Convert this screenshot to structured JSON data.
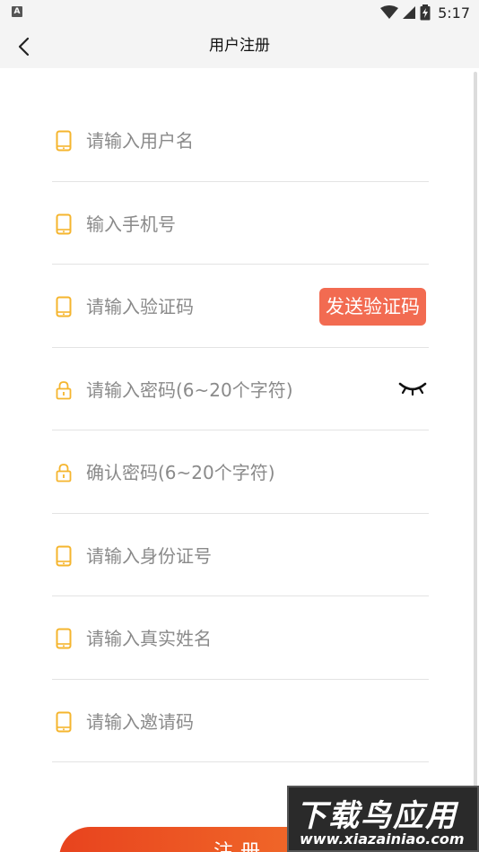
{
  "status_bar": {
    "app_icon_letter": "A",
    "time": "5:17",
    "battery_badge": "8"
  },
  "nav": {
    "title": "用户注册",
    "back_icon": "chevron-left-icon"
  },
  "accent_color": "#f26b51",
  "icon_color": "#f5b52e",
  "form": {
    "username": {
      "placeholder": "请输入用户名",
      "icon": "phone-icon"
    },
    "phone": {
      "placeholder": "输入手机号",
      "icon": "phone-icon"
    },
    "verify_code": {
      "placeholder": "请输入验证码",
      "icon": "phone-icon",
      "button_label": "发送验证码"
    },
    "password": {
      "placeholder": "请输入密码(6~20个字符)",
      "icon": "lock-icon",
      "toggle_icon": "eye-closed-icon"
    },
    "confirm_password": {
      "placeholder": "确认密码(6~20个字符)",
      "icon": "lock-icon"
    },
    "id_card": {
      "placeholder": "请输入身份证号",
      "icon": "phone-icon"
    },
    "real_name": {
      "placeholder": "请输入真实姓名",
      "icon": "phone-icon"
    },
    "invite_code": {
      "placeholder": "请输入邀请码",
      "icon": "phone-icon"
    }
  },
  "register_button_label": "注册",
  "watermark": {
    "title": "下载鸟应用",
    "url": "www.xiazainiao.com"
  }
}
